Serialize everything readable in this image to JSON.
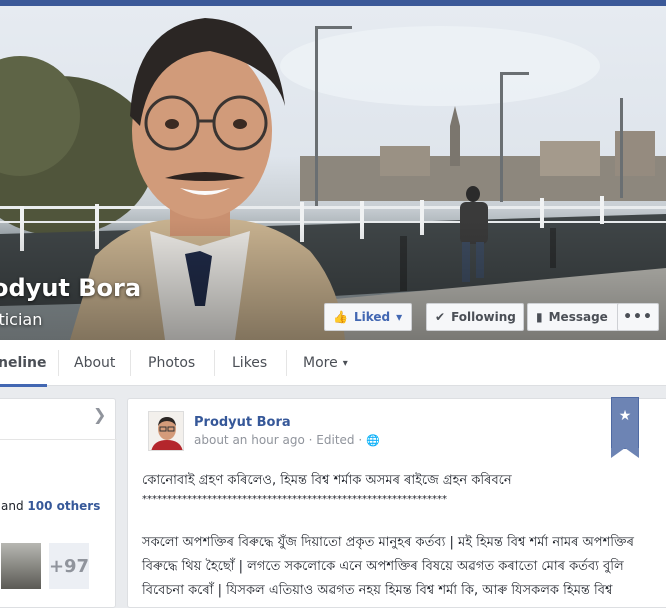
{
  "profile": {
    "name": "odyut Bora",
    "category": "itician"
  },
  "actions": {
    "liked": "Liked",
    "following": "Following",
    "message": "Message",
    "more": "•••"
  },
  "nav": {
    "tabs": [
      "neline",
      "About",
      "Photos",
      "Likes",
      "More"
    ],
    "more_caret": "▾"
  },
  "left_card": {
    "likes_prefix": "and",
    "likes_link": "100 others",
    "plus_count": "+97"
  },
  "post": {
    "author": "Prodyut Bora",
    "time": "about an hour ago",
    "edited": "· Edited ·",
    "line1": "কোনোবাই গ্ৰহণ কৰিলেও, হিমন্ত বিশ্ব শৰ্মাক অসমৰ ৰাইজে গ্ৰহন কৰিবনে",
    "stars": "*************************************************************",
    "para": "সকলো অপশক্তিৰ বিৰুদ্ধে যুঁজ দিয়াতো প্ৰকৃত মানুহৰ কৰ্তব্য | মই হিমন্ত বিশ্ব শৰ্মা নামৰ অপশক্তিৰ বিৰুদ্ধে থিয় হৈছোঁ | লগতে সকলোকে এনে অপশক্তিৰ বিষয়ে অৱগত কৰাতো মোৰ কৰ্তব্য বুলি বিবেচনা কৰোঁ | যিসকল এতিয়াও অৱগত নহয় হিমন্ত বিশ্ব শৰ্মা কি, আৰু যিসকলক হিমন্ত বিশ্ব"
  },
  "colors": {
    "facebook_blue": "#3b5998",
    "link_blue": "#365899",
    "bookmark": "#6d84b4"
  },
  "icons": {
    "liked": "thumbs-up-icon",
    "following": "check-icon",
    "message": "speech-bubble-icon",
    "chevron": "chevron-right-icon",
    "globe": "globe-icon",
    "bookmark": "star-icon"
  }
}
